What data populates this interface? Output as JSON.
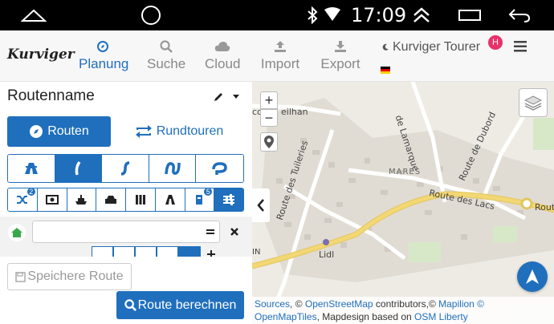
{
  "status": {
    "time": "17:09"
  },
  "header": {
    "logo": "Kurviger",
    "tabs": [
      {
        "label": "Planung",
        "icon": "compass-icon",
        "active": true
      },
      {
        "label": "Suche",
        "icon": "search-icon"
      },
      {
        "label": "Cloud",
        "icon": "cloud-icon"
      },
      {
        "label": "Import",
        "icon": "upload-icon"
      },
      {
        "label": "Export",
        "icon": "download-icon"
      }
    ],
    "account": "Kurviger Tourer",
    "account_badge": "H",
    "language_flag": "german-flag-icon"
  },
  "panel": {
    "route_name": "Routenname",
    "mode_routen": "Routen",
    "mode_rundtouren": "Rundtouren",
    "option_badges": {
      "shuffle": "2",
      "more": "5"
    },
    "save_button": "Speichere Route",
    "calc_button": "Route berechnen"
  },
  "map": {
    "labels": {
      "lamarque": "de Lamarque",
      "dubord": "Route de Dubord",
      "tuileries": "Route des Tuileries",
      "lacs": "Route des Lacs",
      "mares": "MARES",
      "lidl": "Lidl",
      "eilhan": "eilhan",
      "co": "co",
      "in": "IN",
      "route": "Route"
    },
    "attribution": {
      "sources": "Sources",
      "osm": "OpenStreetMap",
      "contributors": " contributors,© ",
      "mapilion": "Mapilion ©",
      "omt": "OpenMapTiles",
      "mapdesign": ", Mapdesign based on ",
      "osm_liberty": "OSM Liberty"
    }
  },
  "colors": {
    "accent": "#1f6fbd",
    "badge": "#e8316b",
    "road": "#f2d774"
  }
}
